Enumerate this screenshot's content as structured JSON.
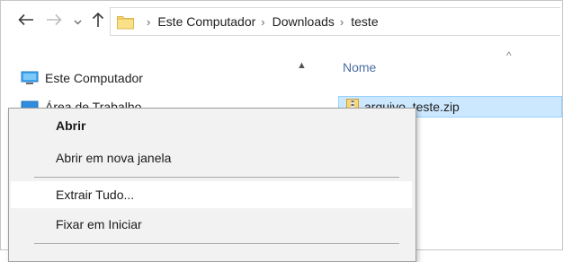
{
  "nav": {
    "back_icon": "arrow-left-icon",
    "forward_icon": "arrow-right-icon",
    "recent_icon": "chevron-down-icon",
    "up_icon": "arrow-up-icon"
  },
  "breadcrumbs": [
    "Este Computador",
    "Downloads",
    "teste"
  ],
  "nav_pane": {
    "items": [
      {
        "label": "Este Computador",
        "icon": "computer-icon"
      },
      {
        "label": "Área de Trabalho",
        "icon": "desktop-icon"
      }
    ]
  },
  "content": {
    "column_header": "Nome",
    "files": [
      {
        "name": "arquivo_teste.zip",
        "icon": "zip-folder-icon",
        "selected": true
      }
    ]
  },
  "context_menu": {
    "items": [
      {
        "label": "Abrir",
        "bold": true
      },
      {
        "label": "Abrir em nova janela"
      },
      {
        "label": "Extrair Tudo...",
        "hover": true
      },
      {
        "label": "Fixar em Iniciar"
      }
    ]
  },
  "colors": {
    "selection_bg": "#cce8ff",
    "selection_border": "#99d1ff",
    "menu_bg": "#f2f2f2",
    "folder_yellow": "#f8d775",
    "header_blue": "#4a6fa5"
  }
}
